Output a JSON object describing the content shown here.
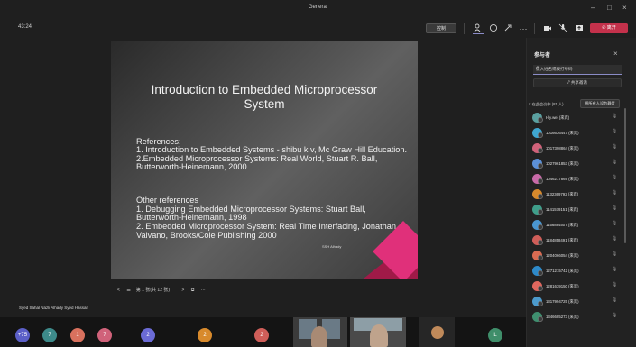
{
  "window": {
    "title": "General",
    "controls": [
      "–",
      "□",
      "×"
    ]
  },
  "toolbar": {
    "timer": "43:24",
    "record_label": "控制",
    "leave_label": "离开",
    "more": "···"
  },
  "slide": {
    "title_line1": "Introduction to Embedded Microprocessor",
    "title_line2": "System",
    "body1": "References:\n1. Introduction to Embedded Systems - shibu k v, Mc Graw Hill Education.\n2.Embedded Microprocessor Systems: Real World, Stuart R. Ball, Butterworth-Heinemann, 2000",
    "body2": "Other references\n1. Debugging Embedded Microprocessor Systems: Stuart Ball, Butterworth-Heinemann, 1998\n2. Embedded Microprocessor System: Real Time Interfacing, Jonathan Valvano, Brooks/Cole Publishing 2000",
    "author": "SSH Alhady"
  },
  "slide_nav": {
    "prev": "<",
    "page": "第 1 张(共 12 张)",
    "next": ">",
    "more": "···"
  },
  "speaker": "Syed Sahal Nazli Alhady Syed Hassan",
  "strip": {
    "count": "+75",
    "avatars": [
      {
        "label": "7",
        "color": "#3d8a8a"
      },
      {
        "label": "1",
        "color": "#d9715e"
      },
      {
        "label": "7",
        "color": "#d0627a"
      },
      {
        "label": "2",
        "color": "#6b6bd6"
      },
      {
        "label": "2",
        "color": "#d88a2c"
      },
      {
        "label": "2",
        "color": "#cf5e59"
      },
      {
        "label": "L",
        "color": "#3f8e6a"
      }
    ]
  },
  "panel": {
    "title": "参与者",
    "search_placeholder": "键入姓名或拨打号码",
    "share_label": "共享邀请",
    "section_label": "在此会议中 (81 人)",
    "mute_all": "将所有人设为静音",
    "participants": [
      {
        "name": "Hly.wei (来宾)",
        "color": "#5aa0a0"
      },
      {
        "name": "1016636447 (来宾)",
        "color": "#3fa6d0"
      },
      {
        "name": "1017398864 (来宾)",
        "color": "#d0627a"
      },
      {
        "name": "1027961853 (来宾)",
        "color": "#5b8fd6"
      },
      {
        "name": "1046217869 (来宾)",
        "color": "#c86aa8"
      },
      {
        "name": "1132369792 (来宾)",
        "color": "#d6892c"
      },
      {
        "name": "1141579151 (来宾)",
        "color": "#3f9e8a"
      },
      {
        "name": "1156884507 (来宾)",
        "color": "#4a96d0"
      },
      {
        "name": "1184858491 (来宾)",
        "color": "#cf5e59"
      },
      {
        "name": "1204066054 (来宾)",
        "color": "#d96b52"
      },
      {
        "name": "1271215742 (来宾)",
        "color": "#2e8ac9"
      },
      {
        "name": "1281639150 (来宾)",
        "color": "#e0675e"
      },
      {
        "name": "1317994725 (来宾)",
        "color": "#4c9acc"
      },
      {
        "name": "1346685273 (来宾)",
        "color": "#3f8f6f"
      }
    ]
  }
}
